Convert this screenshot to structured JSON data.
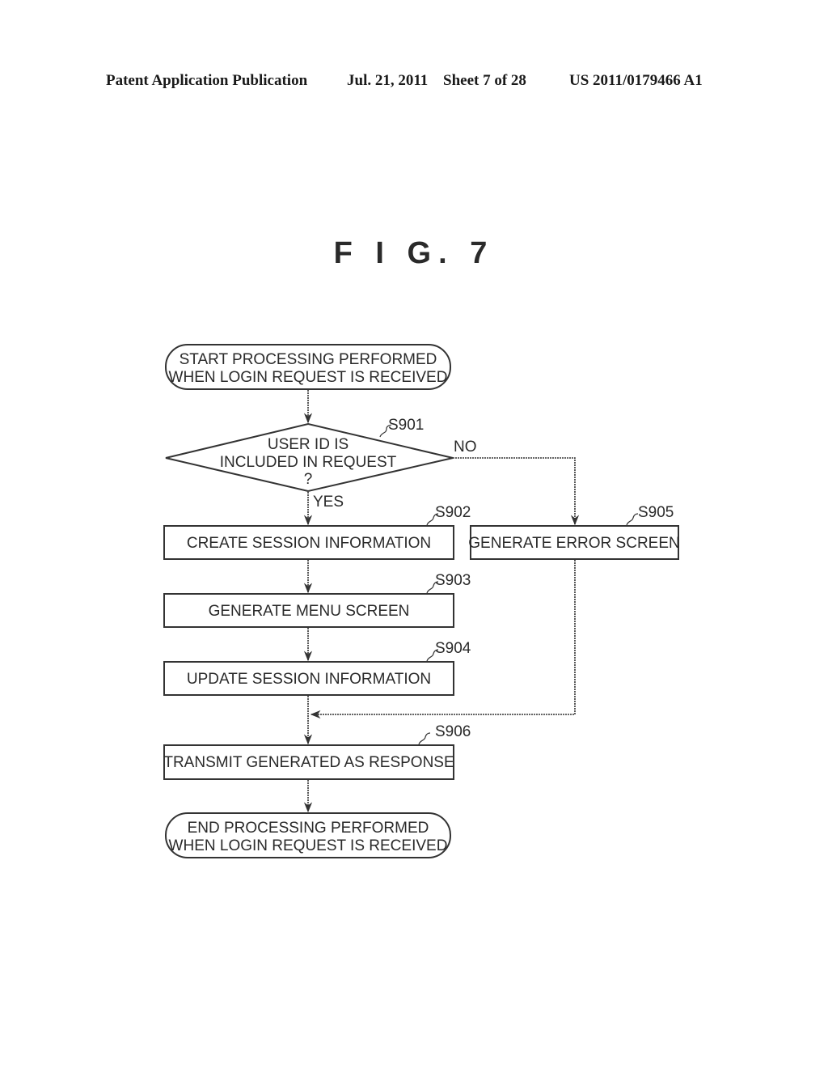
{
  "header": {
    "publication": "Patent Application Publication",
    "date": "Jul. 21, 2011",
    "sheet": "Sheet 7 of 28",
    "number": "US 2011/0179466 A1"
  },
  "figure": {
    "title": "F I G. 7"
  },
  "flowchart": {
    "start": {
      "line1": "START PROCESSING PERFORMED",
      "line2": "WHEN LOGIN REQUEST IS RECEIVED"
    },
    "decision": {
      "step": "S901",
      "line1": "USER ID IS",
      "line2": "INCLUDED IN REQUEST",
      "line3": "?",
      "yes_label": "YES",
      "no_label": "NO"
    },
    "steps": [
      {
        "id": "S902",
        "label": "CREATE SESSION INFORMATION"
      },
      {
        "id": "S903",
        "label": "GENERATE MENU SCREEN"
      },
      {
        "id": "S904",
        "label": "UPDATE SESSION INFORMATION"
      },
      {
        "id": "S905",
        "label": "GENERATE ERROR SCREEN"
      },
      {
        "id": "S906",
        "label": "TRANSMIT GENERATED AS RESPONSE"
      }
    ],
    "end": {
      "line1": "END PROCESSING PERFORMED",
      "line2": "WHEN LOGIN REQUEST IS RECEIVED"
    }
  }
}
